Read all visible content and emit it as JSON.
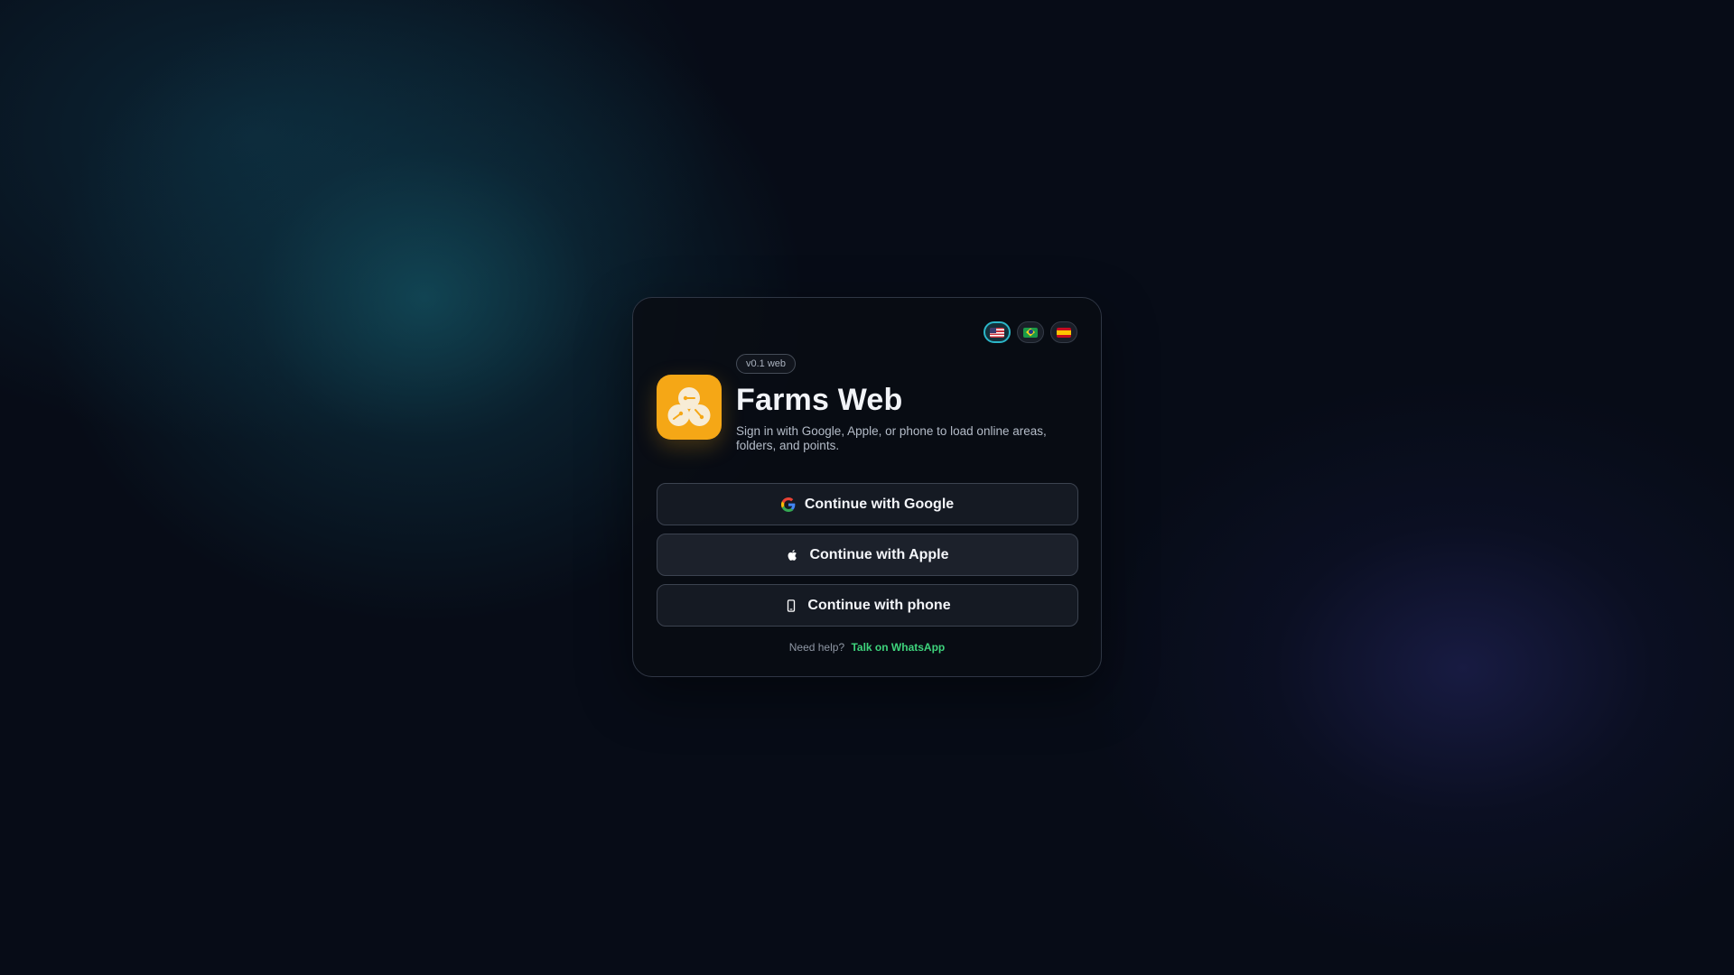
{
  "languages": [
    {
      "icon": "us-flag-icon",
      "selected": true
    },
    {
      "icon": "brazil-flag-icon",
      "selected": false
    },
    {
      "icon": "spain-flag-icon",
      "selected": false
    }
  ],
  "header": {
    "logo_icon": "farms-logo-icon",
    "version": "v0.1 web",
    "title": "Farms Web",
    "subtitle": "Sign in with Google, Apple, or phone to load online areas, folders, and points."
  },
  "auth": {
    "google_label": "Continue with Google",
    "google_icon": "google-icon",
    "apple_label": "Continue with Apple",
    "apple_icon": "apple-icon",
    "phone_label": "Continue with phone",
    "phone_icon": "phone-icon"
  },
  "help": {
    "label": "Need help?",
    "link": "Talk on WhatsApp"
  },
  "colors": {
    "background": "#070c17",
    "logo": "#f5a716",
    "accent_link": "#3ed47c",
    "active_language_border": "#2bb6c8"
  }
}
